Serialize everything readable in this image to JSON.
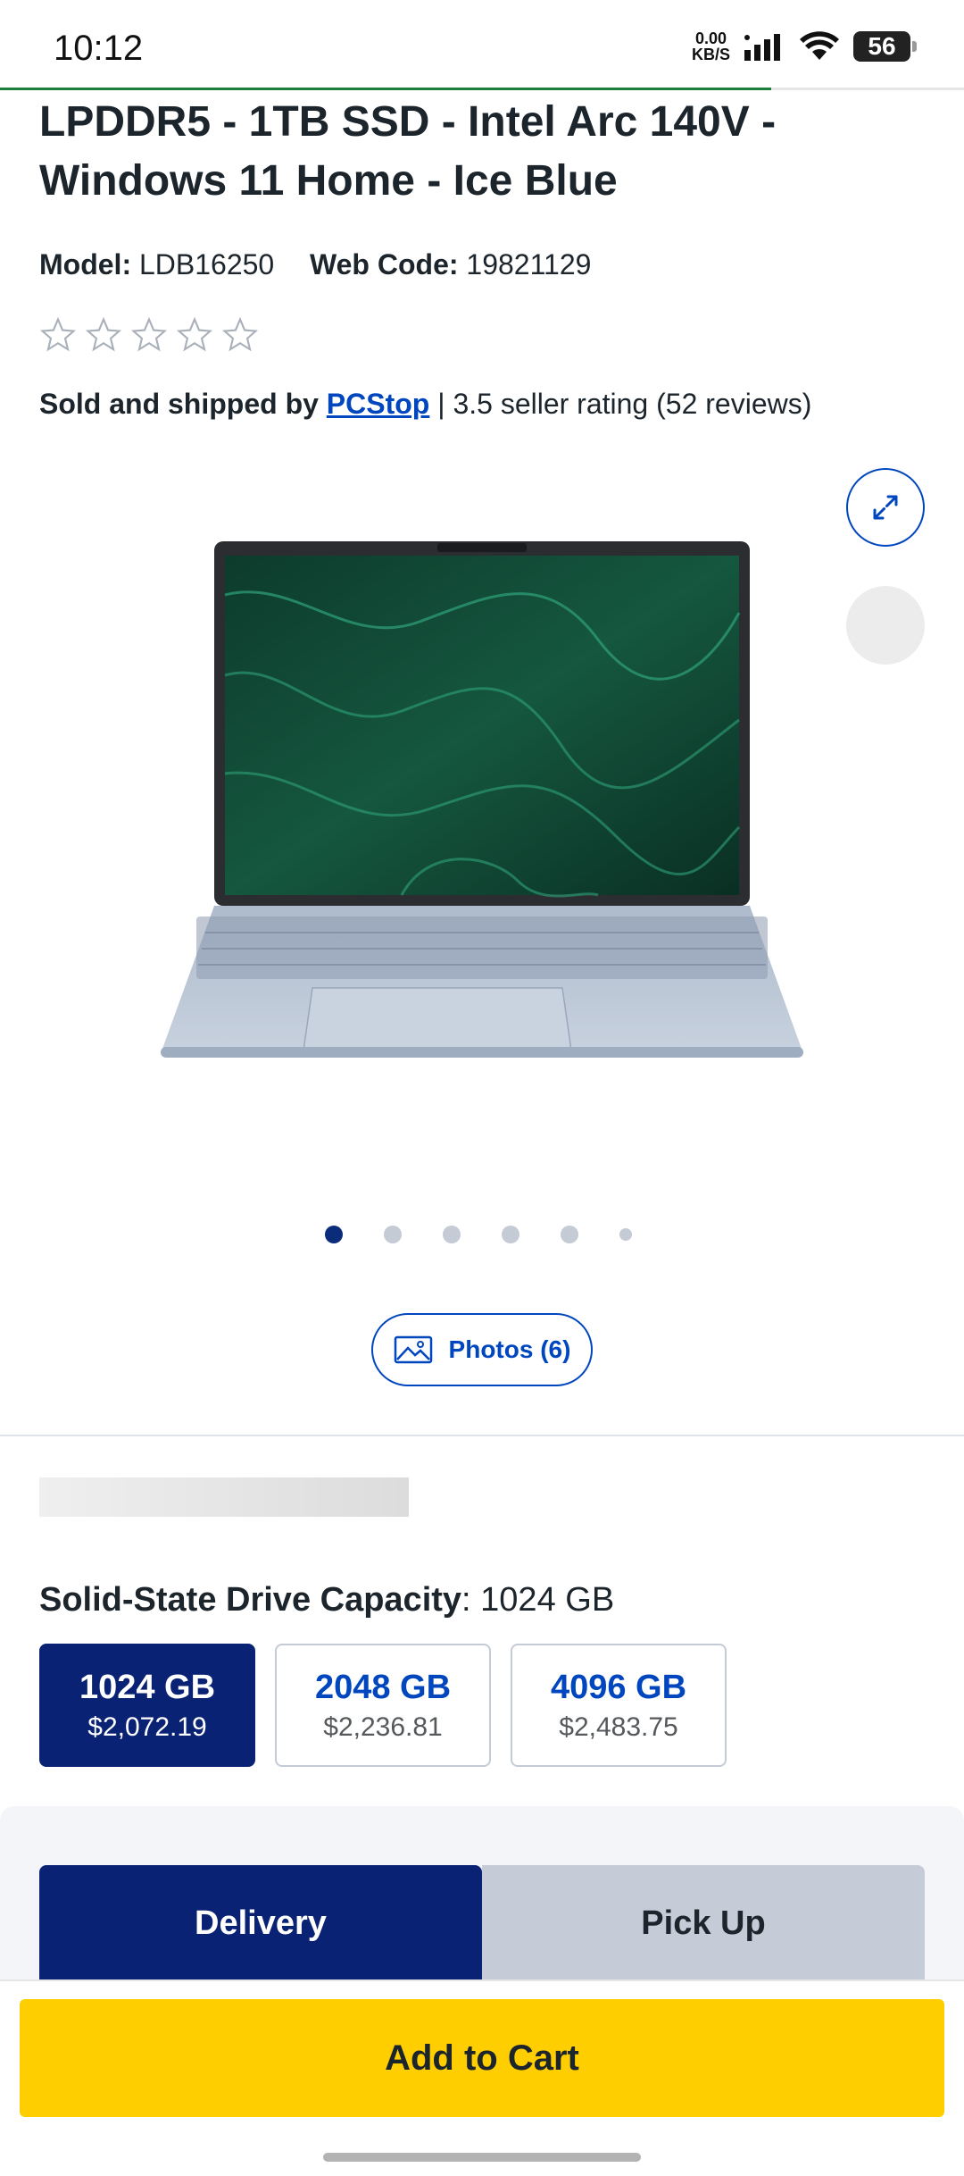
{
  "status_bar": {
    "time": "10:12",
    "net_speed_value": "0.00",
    "net_speed_unit": "KB/S",
    "battery": "56"
  },
  "page_scroll_progress_percent": 80,
  "product": {
    "title": "LPDDR5 - 1TB SSD - Intel Arc 140V - Windows 11 Home - Ice Blue",
    "model_label": "Model:",
    "model_value": "LDB16250",
    "webcode_label": "Web Code:",
    "webcode_value": "19821129",
    "rating_stars_filled": 0,
    "rating_stars_total": 5,
    "seller_prefix": "Sold and shipped by",
    "seller_name": "PCStop",
    "seller_suffix": "| 3.5 seller rating (52 reviews)"
  },
  "gallery": {
    "dots_total": 6,
    "active_dot": 1,
    "photos_button": "Photos (6)"
  },
  "option": {
    "label": "Solid-State Drive Capacity",
    "value": ": 1024 GB",
    "choices": [
      {
        "capacity": "1024 GB",
        "price": "$2,072.19",
        "selected": true
      },
      {
        "capacity": "2048 GB",
        "price": "$2,236.81",
        "selected": false
      },
      {
        "capacity": "4096 GB",
        "price": "$2,483.75",
        "selected": false
      }
    ]
  },
  "fulfillment": {
    "delivery_tab": "Delivery",
    "pickup_tab": "Pick Up"
  },
  "cart": {
    "add_to_cart": "Add to Cart"
  },
  "colors": {
    "brand_blue": "#0046be",
    "navy": "#0a2274",
    "cart_yellow": "#ffce00"
  }
}
